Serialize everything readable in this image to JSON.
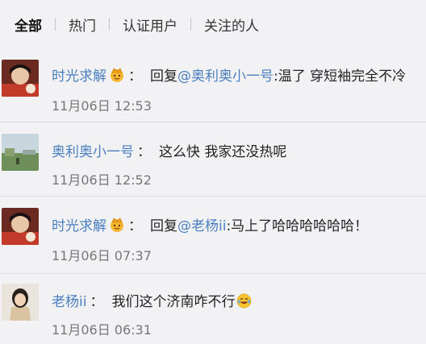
{
  "tabs": [
    {
      "label": "全部"
    },
    {
      "label": "热门"
    },
    {
      "label": "认证用户"
    },
    {
      "label": "关注的人"
    }
  ],
  "comments": [
    {
      "user": "时光求解",
      "badge_icon": "crown-emoji-icon",
      "colon": "：",
      "prefix": "回复",
      "mention": "@奥利奥小一号",
      "text": ":温了 穿短袖完全不冷",
      "time": "11月06日 12:53"
    },
    {
      "user": "奥利奥小一号",
      "colon": "：",
      "text": "这么快 我家还没热呢",
      "time": "11月06日 12:52"
    },
    {
      "user": "时光求解",
      "badge_icon": "crown-emoji-icon",
      "colon": "：",
      "prefix": "回复",
      "mention": "@老杨ii",
      "text": ":马上了哈哈哈哈哈哈！",
      "time": "11月06日 07:37"
    },
    {
      "user": "老杨ii",
      "colon": "：",
      "text": "我们这个济南咋不行",
      "text_emoji_icon": "laughing-tears-emoji-icon",
      "time": "11月06日 06:31"
    }
  ]
}
